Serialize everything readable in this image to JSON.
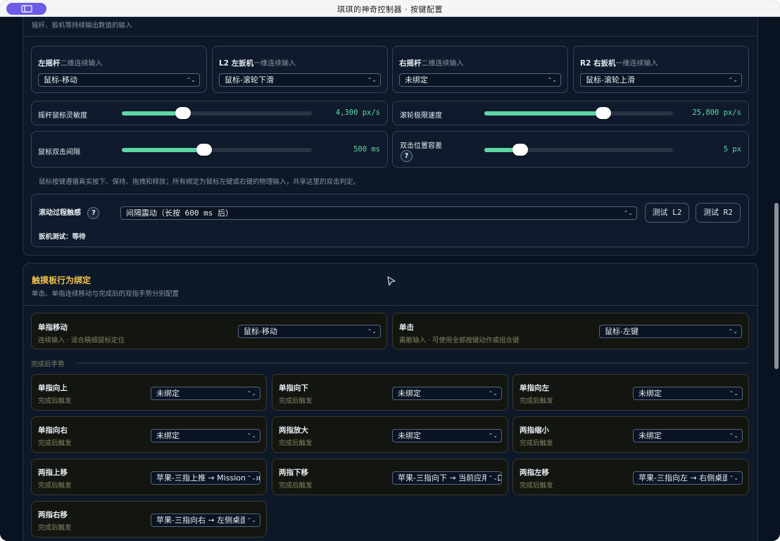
{
  "window": {
    "title": "琪琪的神奇控制器 · 按键配置"
  },
  "colors": {
    "accent": "#5ed6a5",
    "heading": "#f0c14a",
    "titlebar_button": "#6d5ce6"
  },
  "top_panel": {
    "subtitle": "摇杆、扳机等持续输出数值的输入",
    "inputs": [
      {
        "name": "左摇杆",
        "type": "二维连续输入",
        "value": "鼠标-移动"
      },
      {
        "name": "L2 左扳机",
        "type": "一维连续输入",
        "value": "鼠标-滚轮下滑"
      },
      {
        "name": "右摇杆",
        "type": "二维连续输入",
        "value": "未绑定"
      },
      {
        "name": "R2 右扳机",
        "type": "一维连续输入",
        "value": "鼠标-滚轮上滑"
      }
    ],
    "sliders": [
      {
        "label": "摇杆鼠标灵敏度",
        "value_text": "4,300 px/s",
        "level": 0.33
      },
      {
        "label": "滚轮极限速度",
        "value_text": "25,800 px/s",
        "level": 0.63
      },
      {
        "label": "鼠标双击间隔",
        "value_text": "500 ms",
        "level": 0.44
      },
      {
        "label": "双击位置容差",
        "value_text": "5 px",
        "level": 0.19
      }
    ],
    "help_mark": "?",
    "note": "鼠标按键遵循真实按下、保持、拖拽和释放；所有绑定为鼠标左键或右键的物理输入，共享这里的双击判定。",
    "haptics": {
      "label": "滚动过程触感",
      "value": "间隔震动（长按 600 ms 后）",
      "test_l2": "测试 L2",
      "test_r2": "测试 R2",
      "status": "扳机测试：等待"
    }
  },
  "touchpad": {
    "title": "触摸板行为绑定",
    "subtitle": "单击、单指连续移动与完成后的双指手势分别配置",
    "primary": [
      {
        "name": "单指移动",
        "desc": "连续输入 · 适合精细鼠标定位",
        "value": "鼠标-移动"
      },
      {
        "name": "单击",
        "desc": "离散输入 · 可使用全部按键动作或组合键",
        "value": "鼠标-左键"
      }
    ],
    "gesture_header": "完成后手势",
    "gestures": [
      {
        "name": "单指向上",
        "desc": "完成后触发",
        "value": "未绑定"
      },
      {
        "name": "单指向下",
        "desc": "完成后触发",
        "value": "未绑定"
      },
      {
        "name": "单指向左",
        "desc": "完成后触发",
        "value": "未绑定"
      },
      {
        "name": "单指向右",
        "desc": "完成后触发",
        "value": "未绑定"
      },
      {
        "name": "两指放大",
        "desc": "完成后触发",
        "value": "未绑定"
      },
      {
        "name": "两指缩小",
        "desc": "完成后触发",
        "value": "未绑定"
      },
      {
        "name": "两指上移",
        "desc": "完成后触发",
        "value": "苹果-三指上推 → Mission Control"
      },
      {
        "name": "两指下移",
        "desc": "完成后触发",
        "value": "苹果-三指向下 → 当前应用窗口"
      },
      {
        "name": "两指左移",
        "desc": "完成后触发",
        "value": "苹果-三指向左 → 右侧桌面"
      },
      {
        "name": "两指右移",
        "desc": "完成后触发",
        "value": "苹果-三指向右 → 左侧桌面"
      }
    ]
  }
}
